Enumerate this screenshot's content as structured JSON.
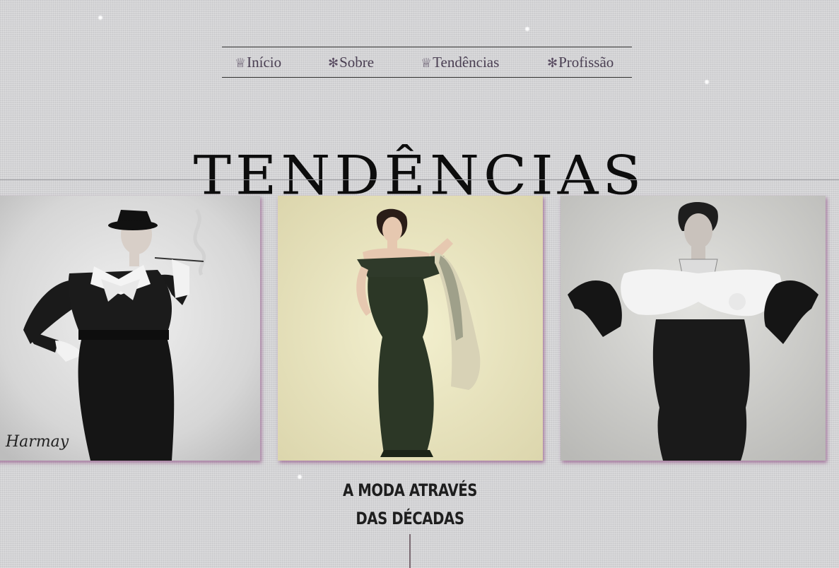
{
  "nav": {
    "items": [
      {
        "icon": "crown-icon",
        "glyph": "♕",
        "label": "Início"
      },
      {
        "icon": "asterisk-flower-icon",
        "glyph": "✻",
        "label": "Sobre"
      },
      {
        "icon": "crown-icon",
        "glyph": "♕",
        "label": "Tendências"
      },
      {
        "icon": "asterisk-flower-icon",
        "glyph": "✻",
        "label": "Profissão"
      }
    ]
  },
  "page": {
    "title": "TENDÊNCIAS"
  },
  "gallery": {
    "photos": [
      {
        "signature": "Harmay"
      },
      {},
      {}
    ]
  },
  "caption": {
    "line1": "A MODA ATRAVÉS",
    "line2": "DAS DÉCADAS"
  },
  "colors": {
    "background": "#d3d3d5",
    "nav_text": "#4a3f52",
    "photo_shadow": "#965a8c"
  }
}
